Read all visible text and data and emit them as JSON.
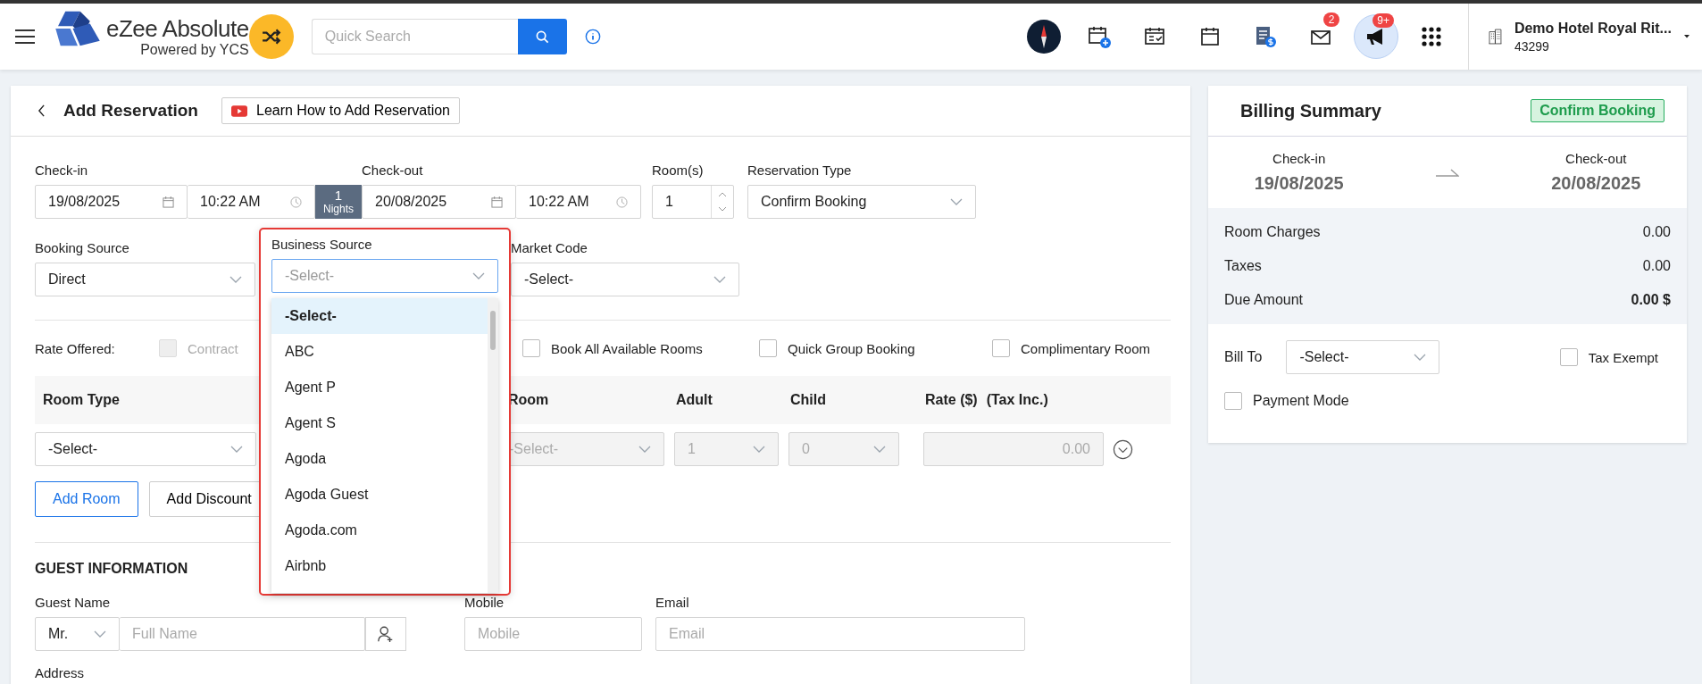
{
  "header": {
    "logo": {
      "name": "eZee Absolute",
      "tagline": "Powered by YCS"
    },
    "search": {
      "placeholder": "Quick Search"
    },
    "toolbar": [
      {
        "kind": "compass",
        "selected": false
      },
      {
        "kind": "calendar-add",
        "selected": false
      },
      {
        "kind": "calendar-check",
        "selected": false
      },
      {
        "kind": "calendar",
        "selected": false
      },
      {
        "kind": "invoice",
        "selected": false
      },
      {
        "kind": "mail",
        "selected": false,
        "badge": "2"
      },
      {
        "kind": "megaphone",
        "selected": true,
        "badge": "9+"
      },
      {
        "kind": "apps",
        "selected": false
      }
    ],
    "hotel": {
      "name": "Demo Hotel Royal Rit...",
      "code": "43299"
    }
  },
  "reservation": {
    "title": "Add Reservation",
    "tutorial_link": "Learn How to Add Reservation",
    "check_in": {
      "label": "Check-in",
      "date": "19/08/2025",
      "time": "10:22 AM"
    },
    "nights": {
      "count": "1",
      "unit": "Nights"
    },
    "check_out": {
      "label": "Check-out",
      "date": "20/08/2025",
      "time": "10:22 AM"
    },
    "rooms": {
      "label": "Room(s)",
      "value": "1"
    },
    "reservation_type": {
      "label": "Reservation Type",
      "value": "Confirm Booking"
    },
    "booking_source": {
      "label": "Booking Source",
      "value": "Direct"
    },
    "business_source": {
      "label": "Business Source",
      "placeholder": "-Select-",
      "expanded": true,
      "options": [
        {
          "label": "-Select-",
          "selected": true
        },
        {
          "label": "ABC",
          "selected": false
        },
        {
          "label": "Agent P",
          "selected": false
        },
        {
          "label": "Agent S",
          "selected": false
        },
        {
          "label": "Agoda",
          "selected": false
        },
        {
          "label": "Agoda Guest",
          "selected": false
        },
        {
          "label": "Agoda.com",
          "selected": false
        },
        {
          "label": "Airbnb",
          "selected": false
        }
      ]
    },
    "market_code": {
      "label": "Market Code",
      "value": "-Select-"
    },
    "rate_offered": {
      "label": "Rate Offered:",
      "options": [
        {
          "label": "Contract",
          "checked": false,
          "disabled": true
        },
        {
          "label": "Book All Available Rooms",
          "checked": false,
          "disabled": false
        },
        {
          "label": "Quick Group Booking",
          "checked": false,
          "disabled": false
        },
        {
          "label": "Complimentary Room",
          "checked": false,
          "disabled": false
        }
      ]
    },
    "room_table": {
      "columns": [
        "Room Type",
        "Room",
        "Adult",
        "Child",
        "Rate ($)",
        "(Tax Inc.)"
      ],
      "rows": [
        {
          "room_type": "-Select-",
          "room": "-Select-",
          "adult": "1",
          "child": "0",
          "rate": "0.00"
        }
      ]
    },
    "buttons": [
      {
        "label": "Add Room",
        "kind": "primary"
      },
      {
        "label": "Add Discount",
        "kind": "default"
      }
    ],
    "guest": {
      "title": "GUEST INFORMATION",
      "name_label": "Guest Name",
      "salutation": "Mr.",
      "name_placeholder": "Full Name",
      "mobile": {
        "label": "Mobile",
        "placeholder": "Mobile"
      },
      "email": {
        "label": "Email",
        "placeholder": "Email"
      },
      "address_label": "Address"
    }
  },
  "billing": {
    "title": "Billing Summary",
    "status": "Confirm Booking",
    "check_in": {
      "label": "Check-in",
      "date": "19/08/2025"
    },
    "check_out": {
      "label": "Check-out",
      "date": "20/08/2025"
    },
    "charges": [
      {
        "label": "Room Charges",
        "amount": "0.00",
        "kind": "line"
      },
      {
        "label": "Taxes",
        "amount": "0.00",
        "kind": "line"
      },
      {
        "label": "Due Amount",
        "amount": "0.00 $",
        "kind": "total"
      }
    ],
    "bill_to": {
      "label": "Bill To",
      "value": "-Select-"
    },
    "tax_exempt": {
      "label": "Tax Exempt",
      "checked": false
    },
    "payment_mode": {
      "label": "Payment Mode",
      "checked": false
    }
  }
}
